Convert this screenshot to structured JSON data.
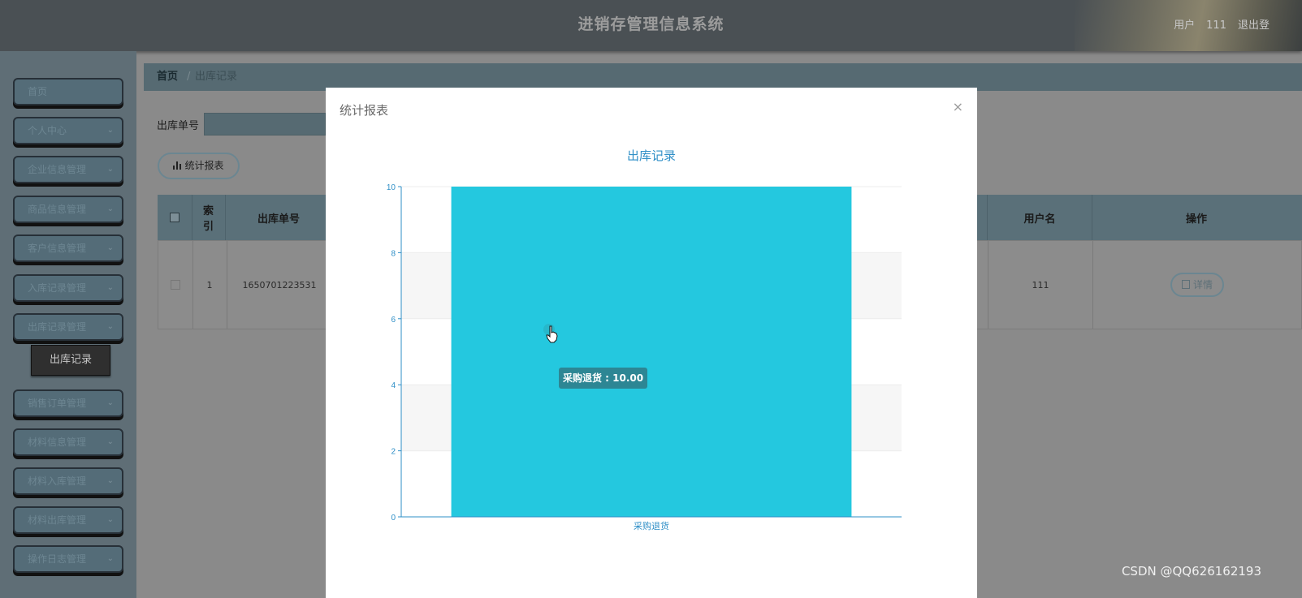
{
  "header": {
    "title": "进销存管理信息系统",
    "user_label": "用户",
    "user_name": "111",
    "logout": "退出登"
  },
  "sidebar": {
    "items": [
      {
        "label": "首页",
        "has_chevron": false
      },
      {
        "label": "个人中心",
        "has_chevron": true
      },
      {
        "label": "企业信息管理",
        "has_chevron": true
      },
      {
        "label": "商品信息管理",
        "has_chevron": true
      },
      {
        "label": "客户信息管理",
        "has_chevron": true
      },
      {
        "label": "入库记录管理",
        "has_chevron": true
      },
      {
        "label": "出库记录管理",
        "has_chevron": true
      },
      {
        "label": "销售订单管理",
        "has_chevron": true
      },
      {
        "label": "材料信息管理",
        "has_chevron": true
      },
      {
        "label": "材料入库管理",
        "has_chevron": true
      },
      {
        "label": "材料出库管理",
        "has_chevron": true
      },
      {
        "label": "操作日志管理",
        "has_chevron": true
      }
    ],
    "sub_item": "出库记录"
  },
  "breadcrumb": {
    "home": "首页",
    "separator": "/",
    "current": "出库记录"
  },
  "search": {
    "label": "出库单号",
    "value": ""
  },
  "report_button": "统计报表",
  "table": {
    "headers": {
      "index": "索引",
      "order_no": "出库单号",
      "username": "用户名",
      "action": "操作"
    },
    "rows": [
      {
        "index": "1",
        "order_no": "1650701223531",
        "username": "111",
        "action": "详情"
      }
    ]
  },
  "modal": {
    "title": "统计报表",
    "close": "×"
  },
  "chart_data": {
    "type": "bar",
    "title": "出库记录",
    "categories": [
      "采购退货"
    ],
    "values": [
      10
    ],
    "ylim": [
      0,
      10
    ],
    "yticks": [
      0,
      2,
      4,
      6,
      8,
      10
    ],
    "bar_color": "#24c8df",
    "axis_color": "#2f8fc7",
    "grid": true,
    "tooltip": "采购退货 : 10.00"
  },
  "watermark": "CSDN @QQ626162193"
}
